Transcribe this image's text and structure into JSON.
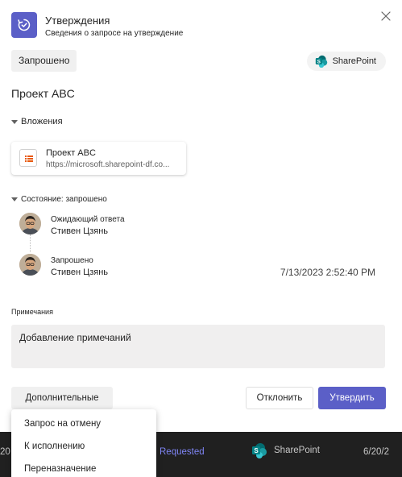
{
  "header": {
    "app_icon": "approval-refresh-icon",
    "title": "Утверждения",
    "subtitle": "Сведения о запросе на утверждение",
    "close_icon": "close-icon"
  },
  "status_chip": "Запрошено",
  "source": {
    "label": "SharePoint",
    "icon": "sharepoint-logo-icon"
  },
  "request_title": "Проект ABC",
  "attachments": {
    "section_label": "Вложения",
    "items": [
      {
        "name": "Проект ABC",
        "url": "https://microsoft.sharepoint-df.co...",
        "icon": "document-icon"
      }
    ]
  },
  "status": {
    "section_label": "Состояние: запрошено",
    "timeline": [
      {
        "label": "Ожидающий ответа",
        "name": "Стивен Цзянь",
        "date": ""
      },
      {
        "label": "Запрошено",
        "name": "Стивен Цзянь",
        "date": "7/13/2023 2:52:40 PM"
      }
    ]
  },
  "notes": {
    "label": "Примечания",
    "placeholder": "Добавление примечаний"
  },
  "actions": {
    "more_label": "Дополнительные действия",
    "reject_label": "Отклонить",
    "approve_label": "Утвердить"
  },
  "menu": {
    "items": [
      "Запрос на отмену",
      "К исполнению",
      "Переназначение"
    ]
  },
  "background_row": {
    "left_fragment": "20",
    "status": "Requested",
    "source": "SharePoint",
    "date": "6/20/2"
  },
  "colors": {
    "accent": "#5b5fc7",
    "background_status": "#7f85f5",
    "sharepoint": "#038387"
  }
}
